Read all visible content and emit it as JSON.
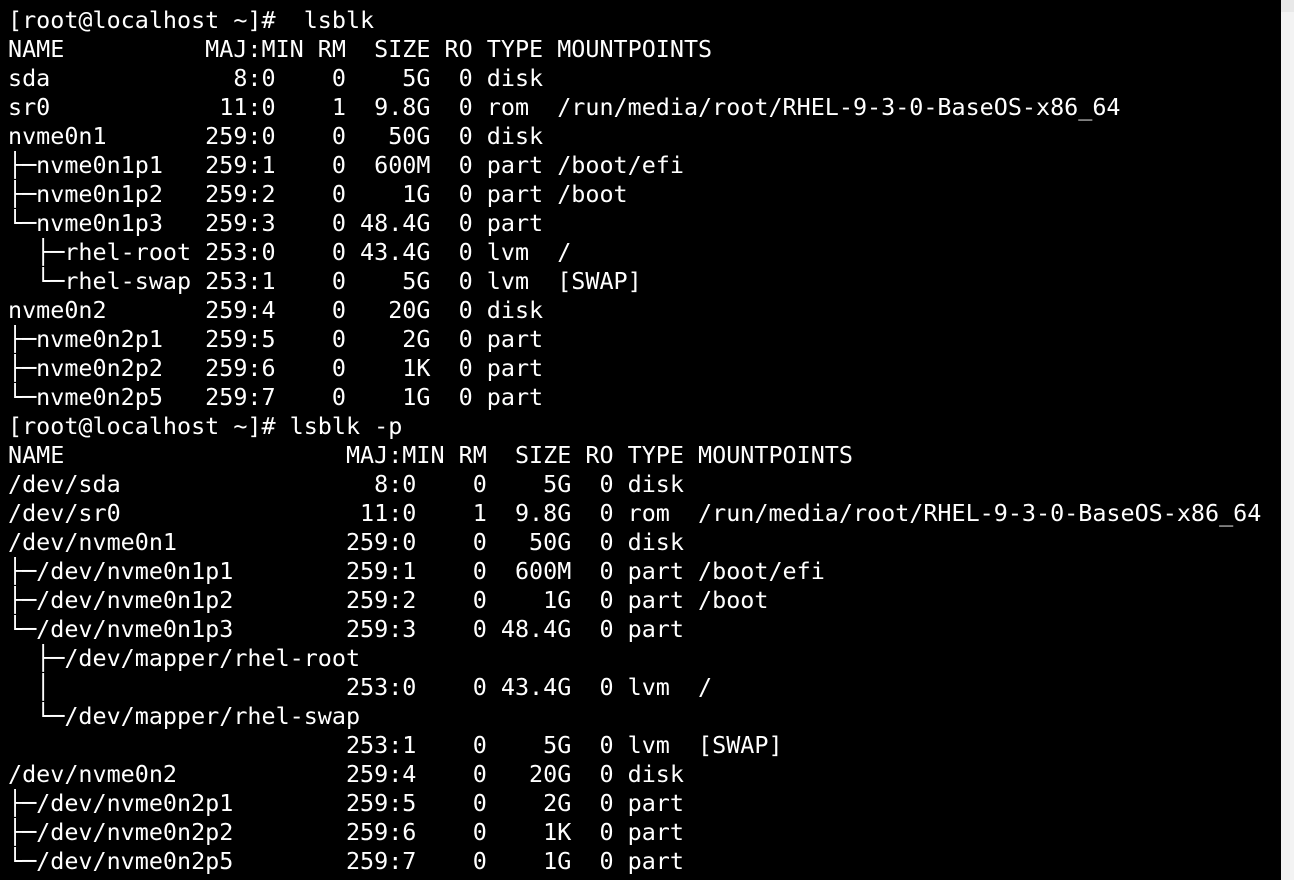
{
  "terminal": {
    "lines": [
      "[root@localhost ~]#  lsblk",
      "NAME          MAJ:MIN RM  SIZE RO TYPE MOUNTPOINTS",
      "sda             8:0    0    5G  0 disk",
      "sr0            11:0    1  9.8G  0 rom  /run/media/root/RHEL-9-3-0-BaseOS-x86_64",
      "nvme0n1       259:0    0   50G  0 disk",
      "├─nvme0n1p1   259:1    0  600M  0 part /boot/efi",
      "├─nvme0n1p2   259:2    0    1G  0 part /boot",
      "└─nvme0n1p3   259:3    0 48.4G  0 part",
      "  ├─rhel-root 253:0    0 43.4G  0 lvm  /",
      "  └─rhel-swap 253:1    0    5G  0 lvm  [SWAP]",
      "nvme0n2       259:4    0   20G  0 disk",
      "├─nvme0n2p1   259:5    0    2G  0 part",
      "├─nvme0n2p2   259:6    0    1K  0 part",
      "└─nvme0n2p5   259:7    0    1G  0 part",
      "[root@localhost ~]# lsblk -p",
      "NAME                    MAJ:MIN RM  SIZE RO TYPE MOUNTPOINTS",
      "/dev/sda                  8:0    0    5G  0 disk",
      "/dev/sr0                 11:0    1  9.8G  0 rom  /run/media/root/RHEL-9-3-0-BaseOS-x86_64",
      "/dev/nvme0n1            259:0    0   50G  0 disk",
      "├─/dev/nvme0n1p1        259:1    0  600M  0 part /boot/efi",
      "├─/dev/nvme0n1p2        259:2    0    1G  0 part /boot",
      "└─/dev/nvme0n1p3        259:3    0 48.4G  0 part",
      "  ├─/dev/mapper/rhel-root",
      "  │                     253:0    0 43.4G  0 lvm  /",
      "  └─/dev/mapper/rhel-swap",
      "                        253:1    0    5G  0 lvm  [SWAP]",
      "/dev/nvme0n2            259:4    0   20G  0 disk",
      "├─/dev/nvme0n2p1        259:5    0    2G  0 part",
      "├─/dev/nvme0n2p2        259:6    0    1K  0 part",
      "└─/dev/nvme0n2p5        259:7    0    1G  0 part"
    ]
  },
  "colors": {
    "background": "#000000",
    "foreground": "#ffffff",
    "scrollbar": "#f3f3f3"
  }
}
